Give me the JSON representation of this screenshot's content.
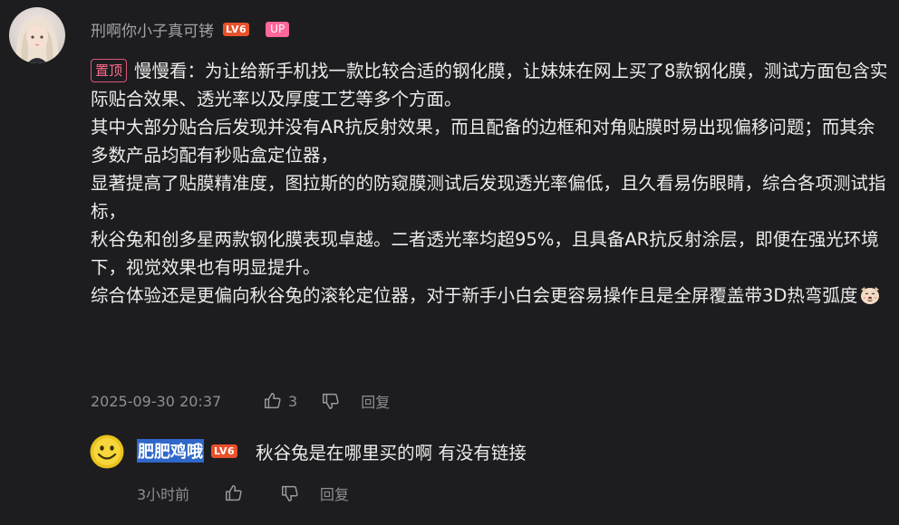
{
  "main_comment": {
    "username": "刑啊你小子真可铐",
    "level_badge": "LV6",
    "up_badge": "UP",
    "pin_label": "置顶",
    "paragraphs": [
      "慢慢看：为让给新手机找一款比较合适的钢化膜，让妹妹在网上买了8款钢化膜，测试方面包含实际贴合效果、透光率以及厚度工艺等多个方面。",
      "其中大部分贴合后发现并没有AR抗反射效果，而且配备的边框和对角贴膜时易出现偏移问题；而其余多数产品均配有秒贴盒定位器，",
      "显著提高了贴膜精准度，图拉斯的的防窥膜测试后发现透光率偏低，且久看易伤眼睛，综合各项测试指标，",
      "秋谷兔和创多星两款钢化膜表现卓越。二者透光率均超95%，且具备AR抗反射涂层，即便在强光环境下，视觉效果也有明显提升。",
      "综合体验还是更偏向秋谷兔的滚轮定位器，对于新手小白会更容易操作且是全屏覆盖带3D热弯弧度"
    ],
    "trailing_emoji": "dog-face-emoji",
    "timestamp": "2025-09-30 20:37",
    "like_count": "3",
    "reply_label": "回复"
  },
  "reply": {
    "username": "肥肥鸡哦",
    "level_badge": "LV6",
    "text": "秋谷兔是在哪里买的啊 有没有链接",
    "timestamp": "3小时前",
    "reply_label": "回复"
  },
  "colors": {
    "background": "#1d1d1f",
    "pin_tag": "#ff6b8e",
    "up_badge": "#ff6699",
    "level_badge": "#e8512a",
    "selection_highlight": "#2f68c9"
  }
}
